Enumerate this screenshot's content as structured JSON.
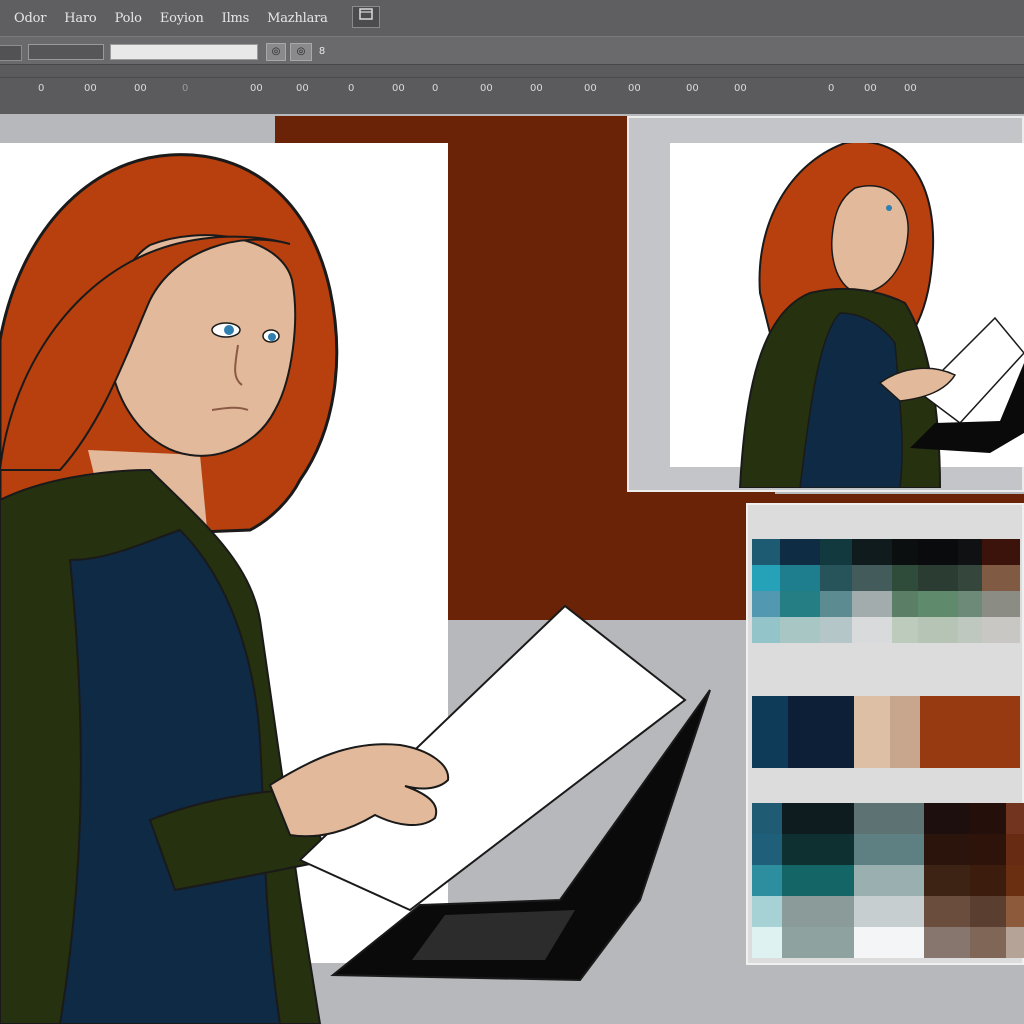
{
  "menubar": {
    "items": [
      "Odor",
      "Haro",
      "Polo",
      "Eoyion",
      "Ilms",
      "Mazhlara"
    ],
    "icon_button": "icon-button"
  },
  "options": {
    "chip_1": "◎",
    "chip_2": "◎",
    "chip_3": "8"
  },
  "ruler": {
    "ticks": [
      "0",
      "00",
      "00",
      "0",
      "00",
      "00",
      "0",
      "00",
      "0",
      "00",
      "00",
      "00",
      "00",
      "00",
      "00",
      "0",
      "00",
      "00"
    ]
  },
  "colors": {
    "chrome": "#5f5f61",
    "canvas": "#b7b8bb",
    "brown": "#6b2307",
    "hair": "#b8400f",
    "cardigan": "#26310f",
    "dress": "#0f2a45",
    "skin": "#e2b99a"
  },
  "palette": {
    "grid_a": [
      [
        "#1d5b73",
        "#0f2c45",
        "#123a3e",
        "#0f1b1d",
        "#0c0f10",
        "#0a0b0c",
        "#0f1112",
        "#3c130b"
      ],
      [
        "#25a2b7",
        "#1f7e8e",
        "#26545a",
        "#445b5c",
        "#2f4b3a",
        "#2b3c32",
        "#35463c",
        "#815a43"
      ],
      [
        "#5298b0",
        "#267e85",
        "#5c8c92",
        "#a2acad",
        "#5b7e66",
        "#5f8a6c",
        "#6d8a78",
        "#8b8d84"
      ],
      [
        "#92c4ca",
        "#a8c7c4",
        "#b4c6c8",
        "#d9dadb",
        "#bccbbc",
        "#b5c4b5",
        "#bec8be",
        "#c8c7c4"
      ]
    ],
    "strip_b": [
      "#0e3b57",
      "#0d1f36",
      "#dcbfa5",
      "#c8a68e",
      "#973a12"
    ],
    "grid_c": [
      [
        "#1f5b73",
        "#0e1c1f",
        "#5d7373",
        "#1c0f0d",
        "#240f0b",
        "#73341f"
      ],
      [
        "#1f5f79",
        "#0f3030",
        "#5f8083",
        "#2b140c",
        "#2e130b",
        "#672a12"
      ],
      [
        "#2d8ea0",
        "#136665",
        "#9ab0b0",
        "#3c2314",
        "#3b1c0d",
        "#6a2f10"
      ],
      [
        "#a6d2d6",
        "#8b9b9a",
        "#c7cecf",
        "#6a4d3d",
        "#5a3f31",
        "#8e5a3c"
      ],
      [
        "#dff2f2",
        "#8ea3a0",
        "#f4f5f6",
        "#87766e",
        "#7f6656",
        "#b4a396"
      ]
    ]
  }
}
